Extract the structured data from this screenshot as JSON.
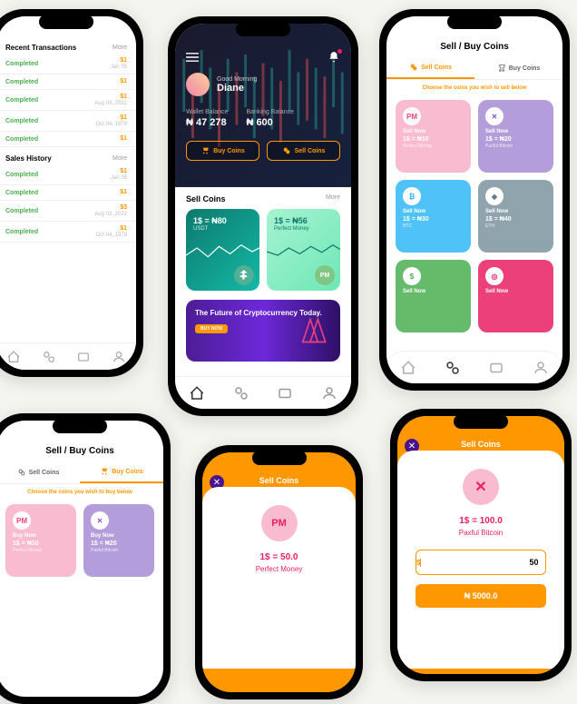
{
  "phone1": {
    "title_recent": "Recent Transactions",
    "more": "More",
    "status_label": "Completed",
    "tx": [
      {
        "amt": "$1",
        "date": "Jan 05"
      },
      {
        "amt": "$1",
        "date": ""
      },
      {
        "amt": "$1",
        "date": "Aug 03, 2022"
      },
      {
        "amt": "$1",
        "date": "Oct 04, 1979"
      },
      {
        "amt": "$1",
        "date": ""
      }
    ],
    "title_history": "Sales History",
    "hist": [
      {
        "amt": "$1",
        "date": "Jan 05"
      },
      {
        "amt": "$1",
        "date": ""
      },
      {
        "amt": "$3",
        "date": "Aug 03, 2022"
      },
      {
        "amt": "$1",
        "date": "Oct 04, 1979"
      }
    ]
  },
  "phone2": {
    "greeting": "Good Morning",
    "name": "Diane",
    "wallet_label": "Wallet Balance",
    "wallet_val": "₦ 47 278",
    "bank_label": "Banking Balance",
    "bank_val": "₦ 600",
    "buy_btn": "Buy Coins",
    "sell_btn": "Sell Coins",
    "section_title": "Sell Coins",
    "section_more": "More",
    "card1_rate": "1$ = ₦80",
    "card1_coin": "USDT",
    "card2_rate": "1$ = ₦56",
    "card2_coin": "Perfect Money",
    "banner_text": "The Future of Cryptocurrency Today.",
    "banner_btn": "BUY NOW"
  },
  "phone3": {
    "title": "Sell / Buy Coins",
    "tab_sell": "Sell Coins",
    "tab_buy": "Buy Coins",
    "choose": "Choose the coins you wish to sell below",
    "action_label": "Sell Now",
    "cells": [
      {
        "rate": "1$ = ₦10",
        "name": "Perfect Money",
        "bg": "#f8bbd0",
        "icon_bg": "#fff",
        "icon_txt": "PM",
        "icon_color": "#ec407a"
      },
      {
        "rate": "1$ = ₦20",
        "name": "Paxful Bitcoin",
        "bg": "#b39ddb",
        "icon_bg": "#fff",
        "icon_txt": "✕",
        "icon_color": "#7e57c2"
      },
      {
        "rate": "1$ = ₦30",
        "name": "BTC",
        "bg": "#4fc3f7",
        "icon_bg": "#fff",
        "icon_txt": "₿",
        "icon_color": "#29b6f6"
      },
      {
        "rate": "1$ = ₦40",
        "name": "ETH",
        "bg": "#90a4ae",
        "icon_bg": "#fff",
        "icon_txt": "◆",
        "icon_color": "#607d8b"
      },
      {
        "rate": "",
        "name": "",
        "bg": "#66bb6a",
        "icon_bg": "#fff",
        "icon_txt": "$",
        "icon_color": "#4caf50"
      },
      {
        "rate": "",
        "name": "",
        "bg": "#ec407a",
        "icon_bg": "#fff",
        "icon_txt": "◎",
        "icon_color": "#e91e63"
      }
    ]
  },
  "phone4": {
    "title": "Sell / Buy Coins",
    "tab_sell": "Sell Coins",
    "tab_buy": "Buy Coins",
    "choose": "Choose the coins you wish to buy below",
    "action_label": "Buy Now",
    "cells": [
      {
        "rate": "1$ = ₦10",
        "name": "Perfect Money",
        "bg": "#f8bbd0",
        "icon_bg": "#fff",
        "icon_txt": "PM",
        "icon_color": "#ec407a"
      },
      {
        "rate": "1$ = ₦20",
        "name": "Paxful Bitcoin",
        "bg": "#b39ddb",
        "icon_bg": "#fff",
        "icon_txt": "✕",
        "icon_color": "#7e57c2"
      }
    ]
  },
  "phone5": {
    "title": "Sell Coins",
    "rate": "1$ = 50.0",
    "coin": "Perfect Money",
    "icon_txt": "PM"
  },
  "phone6": {
    "title": "Sell Coins",
    "rate": "1$ = 100.0",
    "coin": "Paxful Bitcoin",
    "icon_txt": "✕",
    "input_cur": "$",
    "input_val": "50",
    "result": "₦ 5000.0"
  }
}
